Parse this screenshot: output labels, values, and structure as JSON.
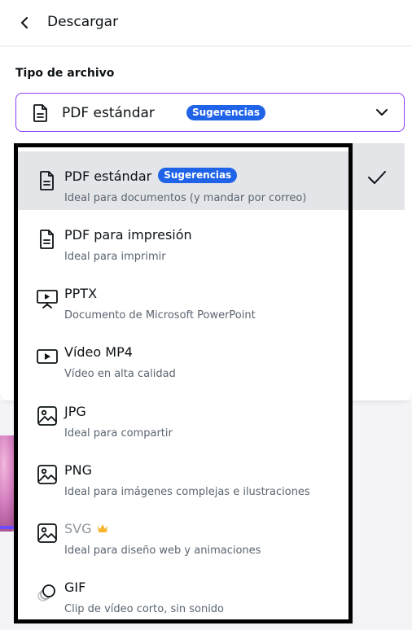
{
  "header": {
    "title": "Descargar",
    "back_icon": "chevron-left-icon"
  },
  "file_type": {
    "label": "Tipo de archivo",
    "selected_value": "PDF estándar",
    "selected_badge": "Sugerencias",
    "accent_color": "#8b3dff",
    "badge_color": "#1f63e8"
  },
  "options": [
    {
      "title": "PDF estándar",
      "badge": "Sugerencias",
      "subtitle": "Ideal para documentos (y mandar por correo)",
      "icon": "document-icon",
      "selected": true
    },
    {
      "title": "PDF para impresión",
      "subtitle": "Ideal para imprimir",
      "icon": "document-icon"
    },
    {
      "title": "PPTX",
      "subtitle": "Documento de Microsoft PowerPoint",
      "icon": "presentation-icon"
    },
    {
      "title": "Vídeo MP4",
      "subtitle": "Vídeo en alta calidad",
      "icon": "video-icon"
    },
    {
      "title": "JPG",
      "subtitle": "Ideal para compartir",
      "icon": "image-icon"
    },
    {
      "title": "PNG",
      "subtitle": "Ideal para imágenes complejas e ilustraciones",
      "icon": "image-icon"
    },
    {
      "title": "SVG",
      "subtitle": "Ideal para diseño web y animaciones",
      "icon": "image-icon",
      "premium": true,
      "premium_icon": "crown-icon"
    },
    {
      "title": "GIF",
      "subtitle": "Clip de vídeo corto, sin sonido",
      "icon": "gif-icon"
    }
  ]
}
